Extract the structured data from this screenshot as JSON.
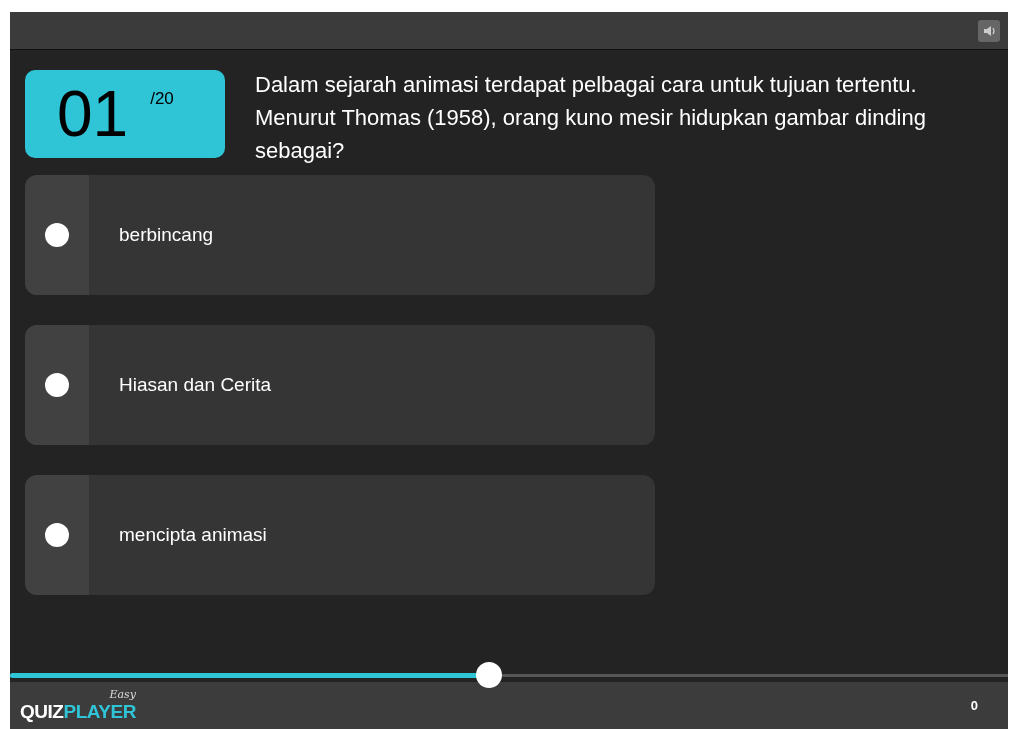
{
  "question": {
    "number": "01",
    "total": "/20",
    "text": "Dalam sejarah animasi terdapat pelbagai cara untuk tujuan tertentu. Menurut Thomas (1958), orang kuno mesir hidupkan gambar dinding sebagai?"
  },
  "options": [
    {
      "label": "berbincang",
      "selected": false
    },
    {
      "label": "Hiasan dan Cerita",
      "selected": false
    },
    {
      "label": "mencipta animasi",
      "selected": false
    }
  ],
  "progress": {
    "level": 0.48
  },
  "footer": {
    "logo": {
      "tagline": "Easy",
      "word_1": "QUIZ",
      "word_2": "PLAYER"
    },
    "score": "0"
  }
}
